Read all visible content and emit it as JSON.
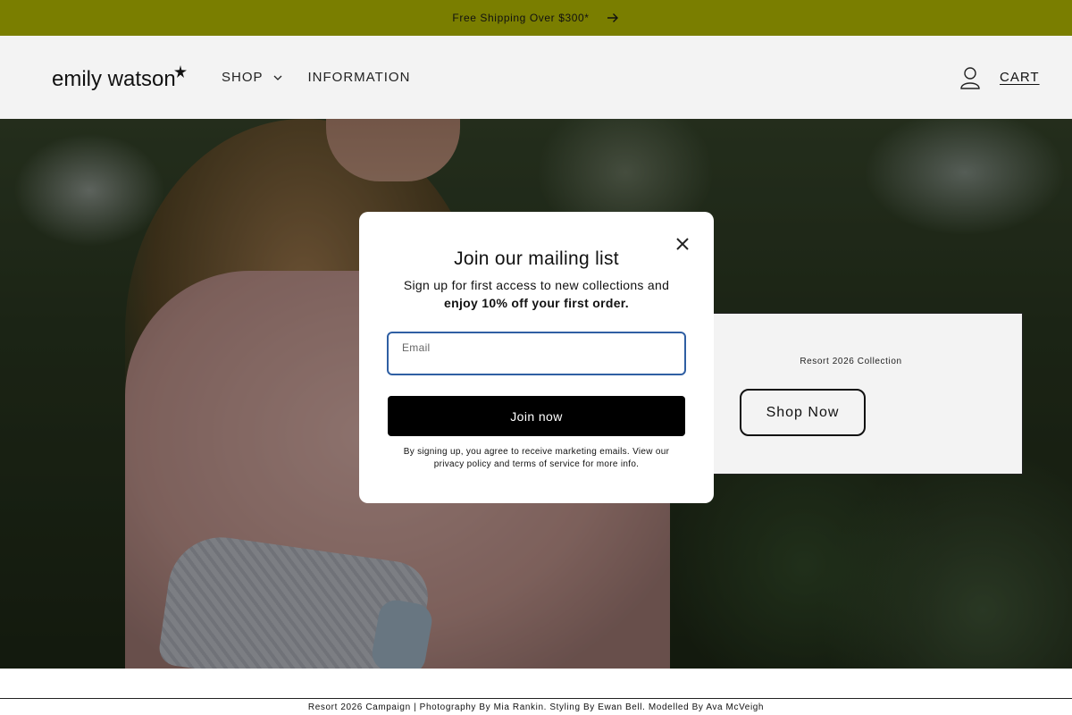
{
  "announcement": {
    "text": "Free Shipping Over $300*",
    "background": "#7a7e00"
  },
  "header": {
    "logo": "emily watson",
    "nav": [
      {
        "label": "SHOP",
        "has_dropdown": true
      },
      {
        "label": "INFORMATION",
        "has_dropdown": false
      }
    ],
    "account_icon": "account-icon",
    "cart_label": "CART"
  },
  "promo": {
    "subtitle": "Resort 2026 Collection",
    "button": "Shop Now"
  },
  "modal": {
    "title": "Join our mailing list",
    "desc_plain": "Sign up for first access to new collections and",
    "desc_bold": "enjoy 10% off your first order.",
    "email_label": "Email",
    "email_value": "",
    "submit": "Join now",
    "disclaimer": "By signing up, you agree to receive marketing emails. View our privacy policy and terms of service for more info.",
    "close_icon": "close-icon"
  },
  "footer": {
    "credits": "Resort 2026 Campaign | Photography By Mia Rankin. Styling By Ewan Bell. Modelled By Ava McVeigh"
  },
  "colors": {
    "accent": "#7a7e00",
    "header_bg": "#f3f3f3",
    "input_focus": "#2f5fa3",
    "button_bg": "#000000"
  }
}
